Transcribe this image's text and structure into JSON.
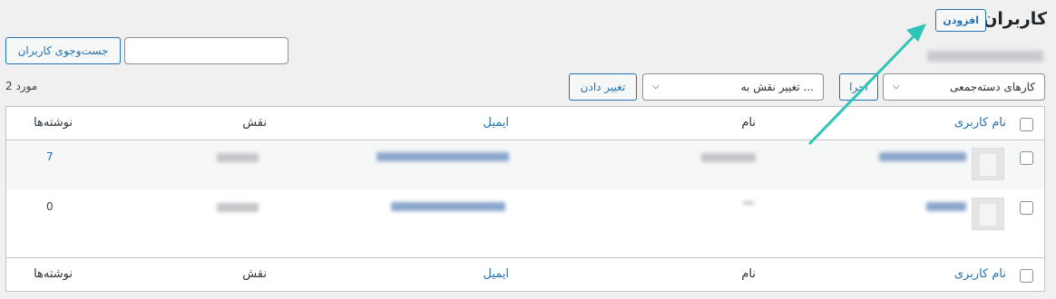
{
  "header": {
    "title": "کاربران",
    "add_button": "افزودن"
  },
  "search": {
    "value": "",
    "button_label": "جست‌وجوی کاربران"
  },
  "toolbar": {
    "bulk_actions_value": "کارهای دسته‌جمعی",
    "apply_button": "اجرا",
    "change_role_value": "تغییر نقش به ...",
    "change_button": "تغییر دادن",
    "items_count": "2 مورد"
  },
  "table": {
    "columns": {
      "username": "نام کاربری",
      "name": "نام",
      "email": "ایمیل",
      "role": "نقش",
      "posts": "نوشته‌ها"
    },
    "rows": [
      {
        "posts": "7"
      },
      {
        "posts": "0"
      }
    ]
  },
  "colors": {
    "accent": "#2271b1",
    "annotation_arrow": "#2ec4b6",
    "background": "#f0f0f1"
  },
  "icons": {
    "dropdown": "chevron-down-icon",
    "avatar": "default-avatar-icon",
    "annotation": "arrow-annotation-icon"
  }
}
